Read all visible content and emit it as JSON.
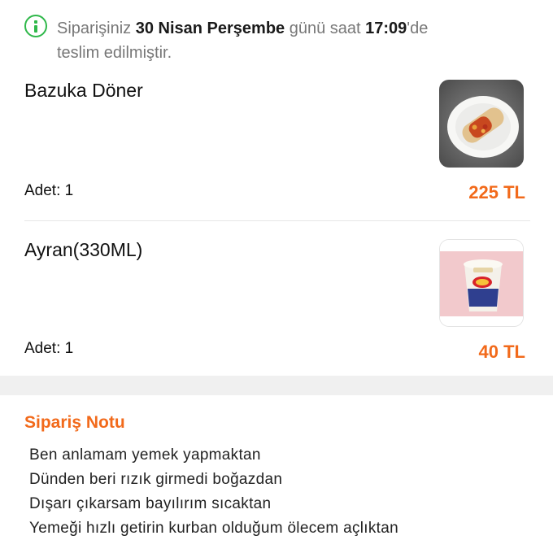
{
  "status": {
    "icon": "info-circle-icon",
    "color": "#2fb84a",
    "prefix": "Siparişiniz",
    "date": "30 Nisan Perşembe",
    "middle": "günü saat",
    "time": "17:09",
    "suffix": "'de",
    "line2": "teslim edilmiştir."
  },
  "items": [
    {
      "name": "Bazuka Döner",
      "qty": "Adet: 1",
      "price": "225 TL",
      "image": "doner-wrap-photo"
    },
    {
      "name": "Ayran(330ML)",
      "qty": "Adet: 1",
      "price": "40 TL",
      "image": "ayran-cup-photo"
    }
  ],
  "note": {
    "title": "Sipariş Notu",
    "lines": [
      "Ben anlamam yemek yapmaktan",
      "Dünden beri rızık girmedi boğazdan",
      "Dışarı çıkarsam bayılırım sıcaktan",
      "Yemeği hızlı getirin kurban olduğum ölecem açlıktan"
    ]
  },
  "colors": {
    "accent": "#f26a1b",
    "success": "#2fb84a"
  }
}
